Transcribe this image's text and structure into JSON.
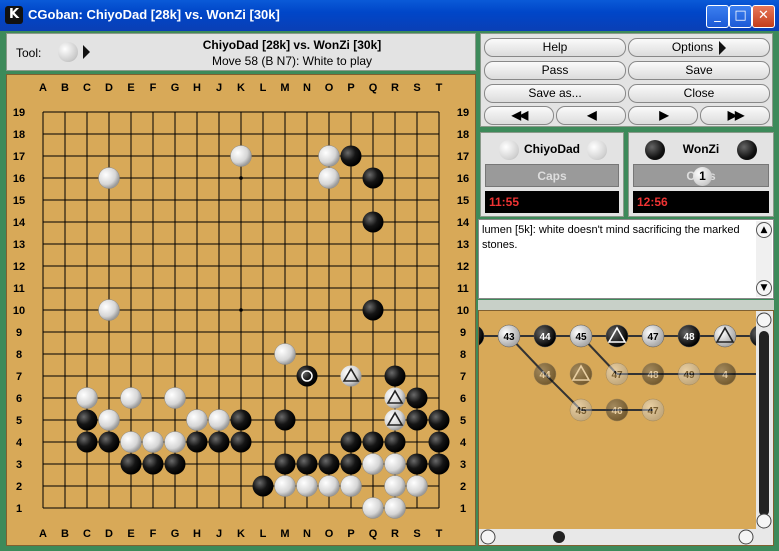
{
  "window": {
    "title": "CGoban: ChiyoDad [28k] vs. WonZi [30k]",
    "app_icon": "K",
    "controls": [
      "_",
      "□",
      "✕"
    ]
  },
  "toolbar": {
    "tool_label": "Tool:",
    "game_title": "ChiyoDad [28k] vs. WonZi [30k]",
    "move_status": "Move 58 (B N7): White to play"
  },
  "buttons": {
    "help": "Help",
    "options": "Options",
    "pass": "Pass",
    "save": "Save",
    "save_as": "Save as...",
    "close": "Close"
  },
  "players": {
    "white": {
      "name": "ChiyoDad",
      "caps": "Caps",
      "clock": "11:55"
    },
    "black": {
      "name": "WonZi",
      "caps": "Caps",
      "caps_count": "1",
      "clock": "12:56"
    }
  },
  "chat": {
    "message": "lumen [5k]: white doesn't mind sacrificing the marked stones."
  },
  "board": {
    "columns": [
      "A",
      "B",
      "C",
      "D",
      "E",
      "F",
      "G",
      "H",
      "J",
      "K",
      "L",
      "M",
      "N",
      "O",
      "P",
      "Q",
      "R",
      "S",
      "T"
    ],
    "rows": [
      "19",
      "18",
      "17",
      "16",
      "15",
      "14",
      "13",
      "12",
      "11",
      "10",
      "9",
      "8",
      "7",
      "6",
      "5",
      "4",
      "3",
      "2",
      "1"
    ],
    "white_stones": [
      "K17",
      "O17",
      "O16",
      "D16",
      "D10",
      "M8",
      "C6",
      "E6",
      "G6",
      "D5",
      "H5",
      "J5",
      "E4",
      "F4",
      "G4",
      "Q3",
      "R3",
      "M2",
      "N2",
      "O2",
      "P2",
      "R2",
      "S2",
      "Q1",
      "R1"
    ],
    "black_stones": [
      "P17",
      "Q16",
      "Q14",
      "Q10",
      "R7",
      "S6",
      "C5",
      "K5",
      "M5",
      "S5",
      "T5",
      "C4",
      "D4",
      "H4",
      "J4",
      "K4",
      "P4",
      "Q4",
      "R4",
      "T4",
      "E3",
      "F3",
      "G3",
      "M3",
      "N3",
      "O3",
      "P3",
      "S3",
      "T3",
      "L2"
    ],
    "triangle_black": [
      "R6",
      "R5"
    ],
    "triangle_white": [
      "P7"
    ],
    "last_move": "N7",
    "star_points": [
      "D16",
      "K16",
      "Q16",
      "D10",
      "K10",
      "Q10",
      "D4",
      "K4",
      "Q4"
    ]
  },
  "tree": {
    "row1": [
      {
        "label": "",
        "color": "black"
      },
      {
        "label": "43",
        "color": "white"
      },
      {
        "label": "44",
        "color": "black"
      },
      {
        "label": "45",
        "color": "white"
      },
      {
        "label": "",
        "color": "black-tri"
      },
      {
        "label": "47",
        "color": "white"
      },
      {
        "label": "48",
        "color": "black"
      },
      {
        "label": "",
        "color": "white-tri"
      },
      {
        "label": "",
        "color": "black"
      }
    ],
    "row2": [
      {
        "label": "44",
        "color": "black-faint"
      },
      {
        "label": "",
        "color": "black-faint-tri"
      },
      {
        "label": "47",
        "color": "white-faint"
      },
      {
        "label": "48",
        "color": "black-faint"
      },
      {
        "label": "49",
        "color": "white-faint"
      },
      {
        "label": "4",
        "color": "black-faint"
      }
    ],
    "row3": [
      {
        "label": "45",
        "color": "white-faint"
      },
      {
        "label": "46",
        "color": "black-faint"
      },
      {
        "label": "47",
        "color": "white-faint"
      }
    ]
  }
}
